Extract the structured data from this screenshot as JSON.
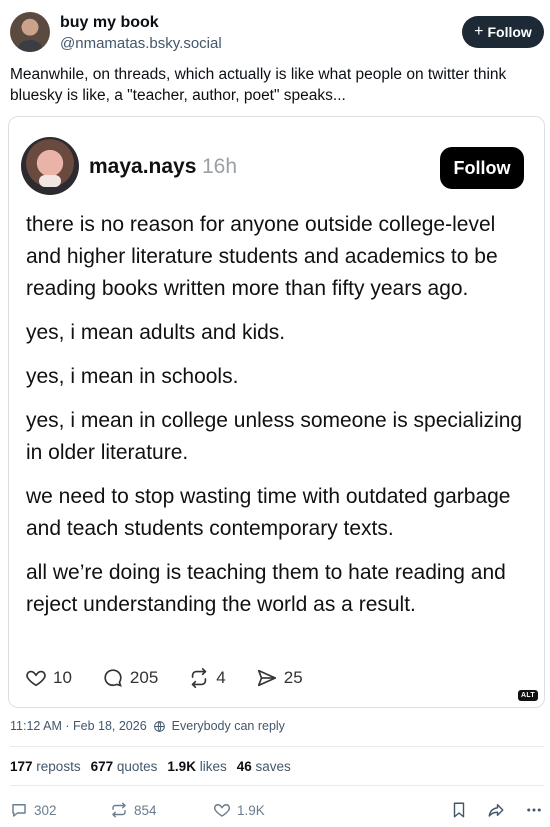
{
  "author": {
    "display_name": "buy my book",
    "handle": "@nmamatas.bsky.social",
    "follow_label": "Follow"
  },
  "post": {
    "text": "Meanwhile, on threads, which actually is like what people on twitter think bluesky is like, a \"teacher, author, poet\" speaks...",
    "timestamp": "11:12 AM · Feb 18, 2026",
    "reply_setting": "Everybody can reply"
  },
  "embed": {
    "name": "maya.nays",
    "time": "16h",
    "follow_label": "Follow",
    "paragraphs": [
      "there is no reason for anyone outside college-level and higher literature students and academics to be reading books written more than fifty years ago.",
      "yes, i mean adults and kids.",
      "yes, i mean in schools.",
      "yes, i mean in college unless someone is specializing in older literature.",
      "we need to stop wasting time with outdated garbage and teach students contemporary texts.",
      "all we’re doing is teaching them to hate reading and reject understanding the world as a result."
    ],
    "likes": "10",
    "replies": "205",
    "reposts": "4",
    "shares": "25",
    "alt_badge": "ALT"
  },
  "stats": {
    "reposts_count": "177",
    "reposts_label": "reposts",
    "quotes_count": "677",
    "quotes_label": "quotes",
    "likes_count": "1.9K",
    "likes_label": "likes",
    "saves_count": "46",
    "saves_label": "saves"
  },
  "actions": {
    "replies": "302",
    "reposts": "854",
    "likes": "1.9K"
  },
  "icons": {
    "follow_plus": "plus-icon",
    "globe": "globe-icon",
    "reply": "speech-bubble-icon",
    "repost": "repost-icon",
    "like": "heart-icon",
    "bookmark": "bookmark-icon",
    "share": "share-arrow-icon",
    "more": "more-icon"
  }
}
